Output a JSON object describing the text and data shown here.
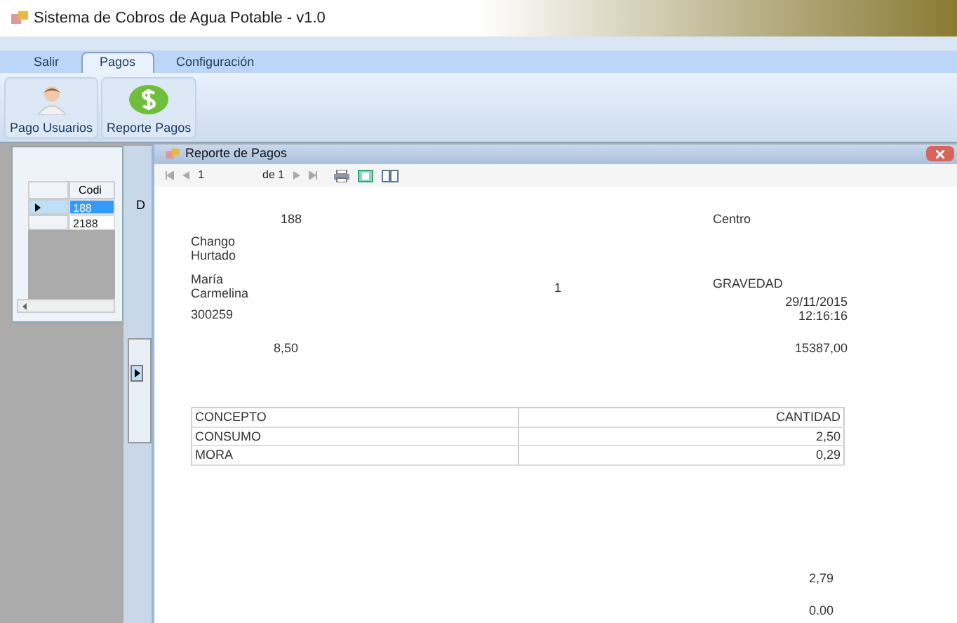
{
  "window": {
    "title": "Sistema de Cobros de Agua Potable - v1.0"
  },
  "tabs": [
    {
      "label": "Salir",
      "selected": false
    },
    {
      "label": "Pagos",
      "selected": true
    },
    {
      "label": "Configuración",
      "selected": false
    }
  ],
  "ribbon_buttons": [
    {
      "label": "Pago Usuarios",
      "kind": "user"
    },
    {
      "label": "Reporte Pagos",
      "kind": "money"
    }
  ],
  "background_grid": {
    "columns": [
      "Codi"
    ],
    "rows": [
      {
        "cells": [
          "188"
        ],
        "selected": true
      },
      {
        "cells": [
          "2188"
        ],
        "selected": false
      }
    ]
  },
  "background_panel": {
    "label": "D"
  },
  "report_window": {
    "title": "Reporte de Pagos",
    "page": "1",
    "page_count": "de 1",
    "fields": {
      "code": "188",
      "sector": "Centro",
      "surname": "Chango Hurtado",
      "given_name": "María Carmelina",
      "count": "1",
      "category": "GRAVEDAD",
      "meter": "300259",
      "date_time": "29/11/2015 12:16:16",
      "rate": "8,50",
      "reading": "15387,00"
    },
    "table": {
      "columns": [
        "CONCEPTO",
        "CANTIDAD"
      ],
      "rows": [
        [
          "CONSUMO",
          "2,50"
        ],
        [
          "MORA",
          "0,29"
        ]
      ]
    },
    "total": "2,79",
    "balance": "0.00"
  }
}
